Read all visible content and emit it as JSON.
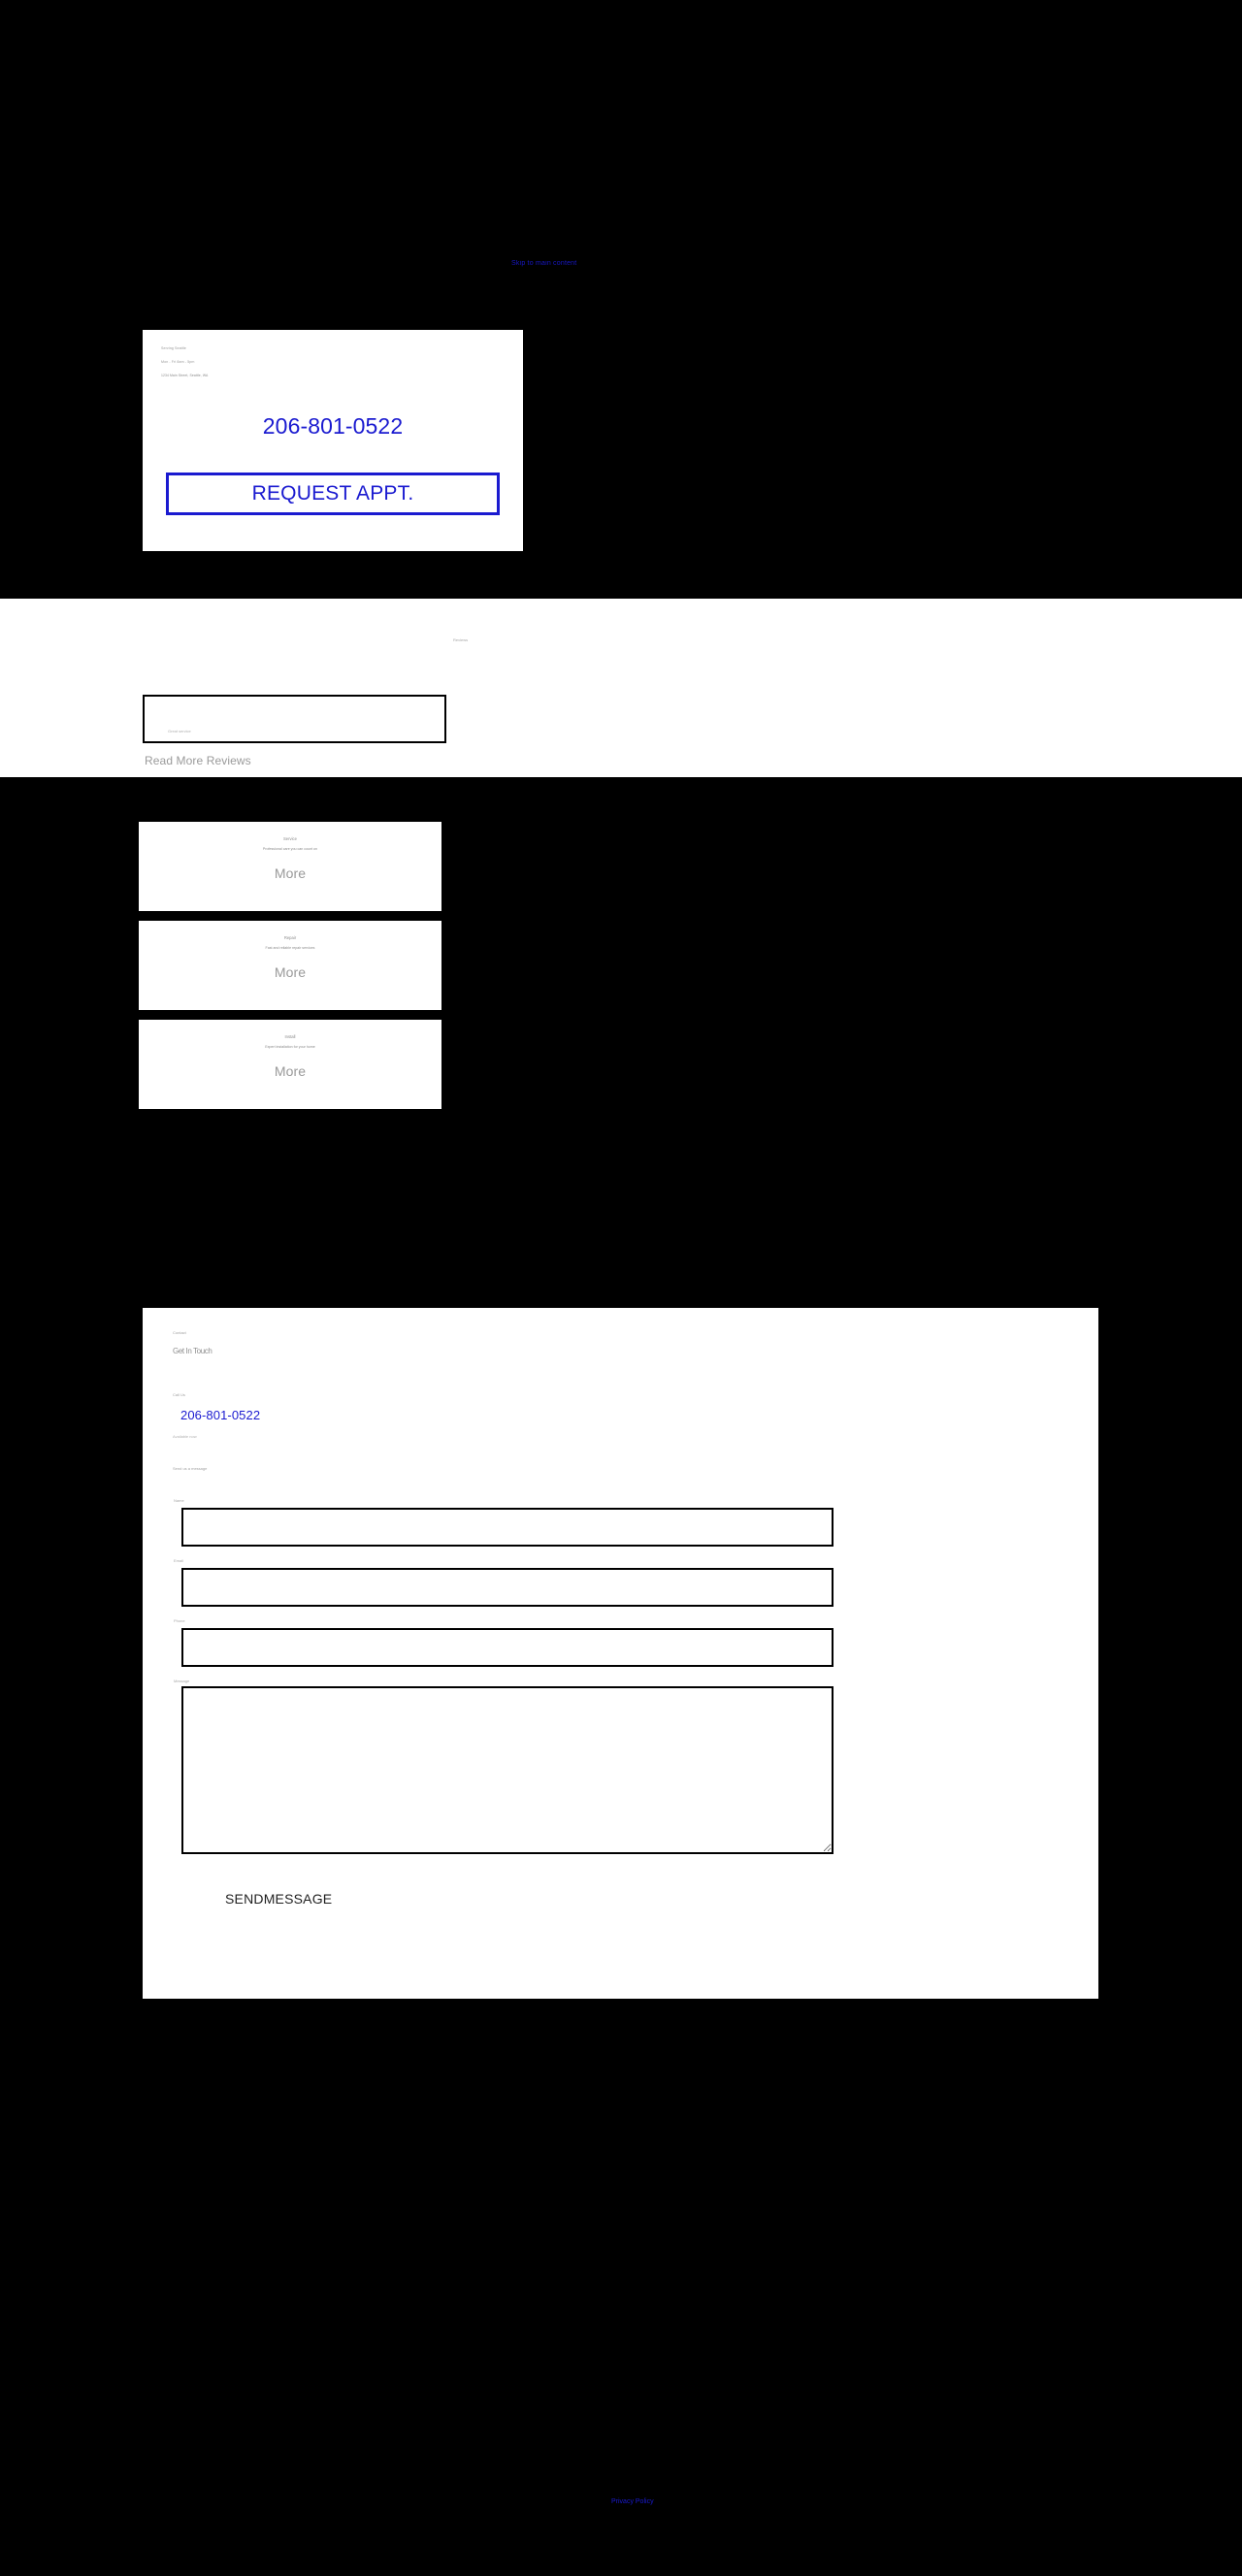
{
  "colors": {
    "page_background": "#000000",
    "card_background": "#ffffff",
    "accent_blue": "#1a1ad0",
    "muted_text": "#9a9a9a",
    "border_black": "#000000"
  },
  "hero": {
    "top_link_label": "Skip to main content",
    "micro_lines": [
      "Serving Seattle",
      "Mon - Fri 8am - 5pm",
      "1234 Main Street, Seattle, WA"
    ],
    "phone": "206-801-0522",
    "request_button_label": "REQUEST APPT."
  },
  "reviews": {
    "micro_heading": "Reviews",
    "review_snippet": "Great service",
    "read_more_label": "Read More Reviews"
  },
  "info_cards": [
    {
      "title": "Service",
      "subtitle": "Professional care you can count on",
      "more_label": "More"
    },
    {
      "title": "Repair",
      "subtitle": "Fast and reliable repair services",
      "more_label": "More"
    },
    {
      "title": "Install",
      "subtitle": "Expert installation for your home",
      "more_label": "More"
    }
  ],
  "contact": {
    "eyebrow": "Contact",
    "heading": "Get In Touch",
    "phone_label": "Call Us",
    "phone": "206-801-0522",
    "phone_sub": "Available now",
    "form_eyebrow": "Send us a message",
    "fields": [
      {
        "label": "Name",
        "value": "",
        "placeholder": ""
      },
      {
        "label": "Email",
        "value": "",
        "placeholder": ""
      },
      {
        "label": "Phone",
        "value": "",
        "placeholder": ""
      },
      {
        "label": "Message",
        "value": "",
        "placeholder": ""
      }
    ],
    "submit_label": "SENDMESSAGE"
  },
  "footer": {
    "link_label": "Privacy Policy"
  }
}
